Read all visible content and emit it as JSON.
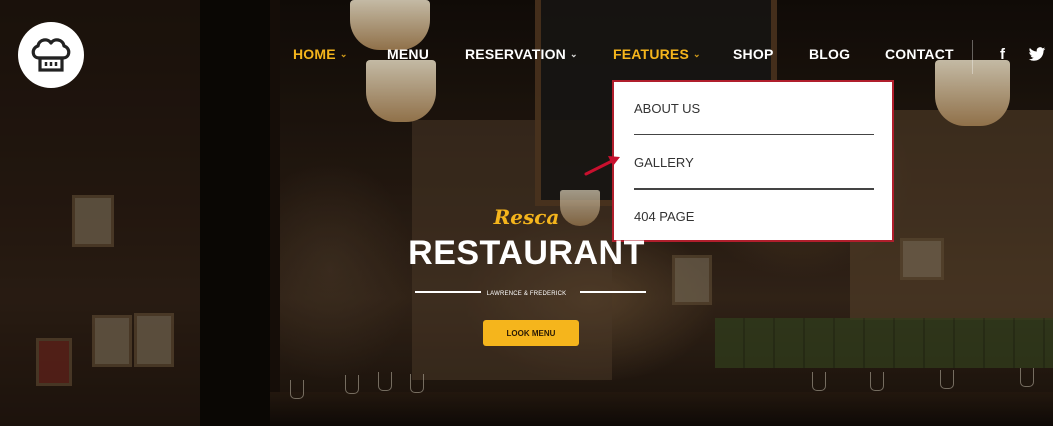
{
  "nav": {
    "items": [
      {
        "label": "HOME",
        "active": true,
        "has_dropdown": true
      },
      {
        "label": "MENU",
        "active": false,
        "has_dropdown": false
      },
      {
        "label": "RESERVATION",
        "active": false,
        "has_dropdown": true
      },
      {
        "label": "FEATURES",
        "active": true,
        "has_dropdown": true
      },
      {
        "label": "SHOP",
        "active": false,
        "has_dropdown": false
      },
      {
        "label": "BLOG",
        "active": false,
        "has_dropdown": false
      },
      {
        "label": "CONTACT",
        "active": false,
        "has_dropdown": false
      }
    ],
    "social": [
      {
        "icon": "facebook-icon",
        "glyph": "f"
      },
      {
        "icon": "twitter-icon",
        "glyph": "🐦"
      }
    ]
  },
  "features_dropdown": {
    "items": [
      "ABOUT US",
      "GALLERY",
      "404 PAGE"
    ]
  },
  "hero": {
    "script_title": "Resca",
    "title": "RESTAURANT",
    "subtitle": "LAWRENCE & FREDERICK",
    "cta_label": "LOOK MENU"
  },
  "colors": {
    "accent": "#f5b51c",
    "dropdown_border": "#b01e2c",
    "annotation_arrow": "#c8102e"
  },
  "logo": {
    "icon": "chef-hat-icon"
  }
}
